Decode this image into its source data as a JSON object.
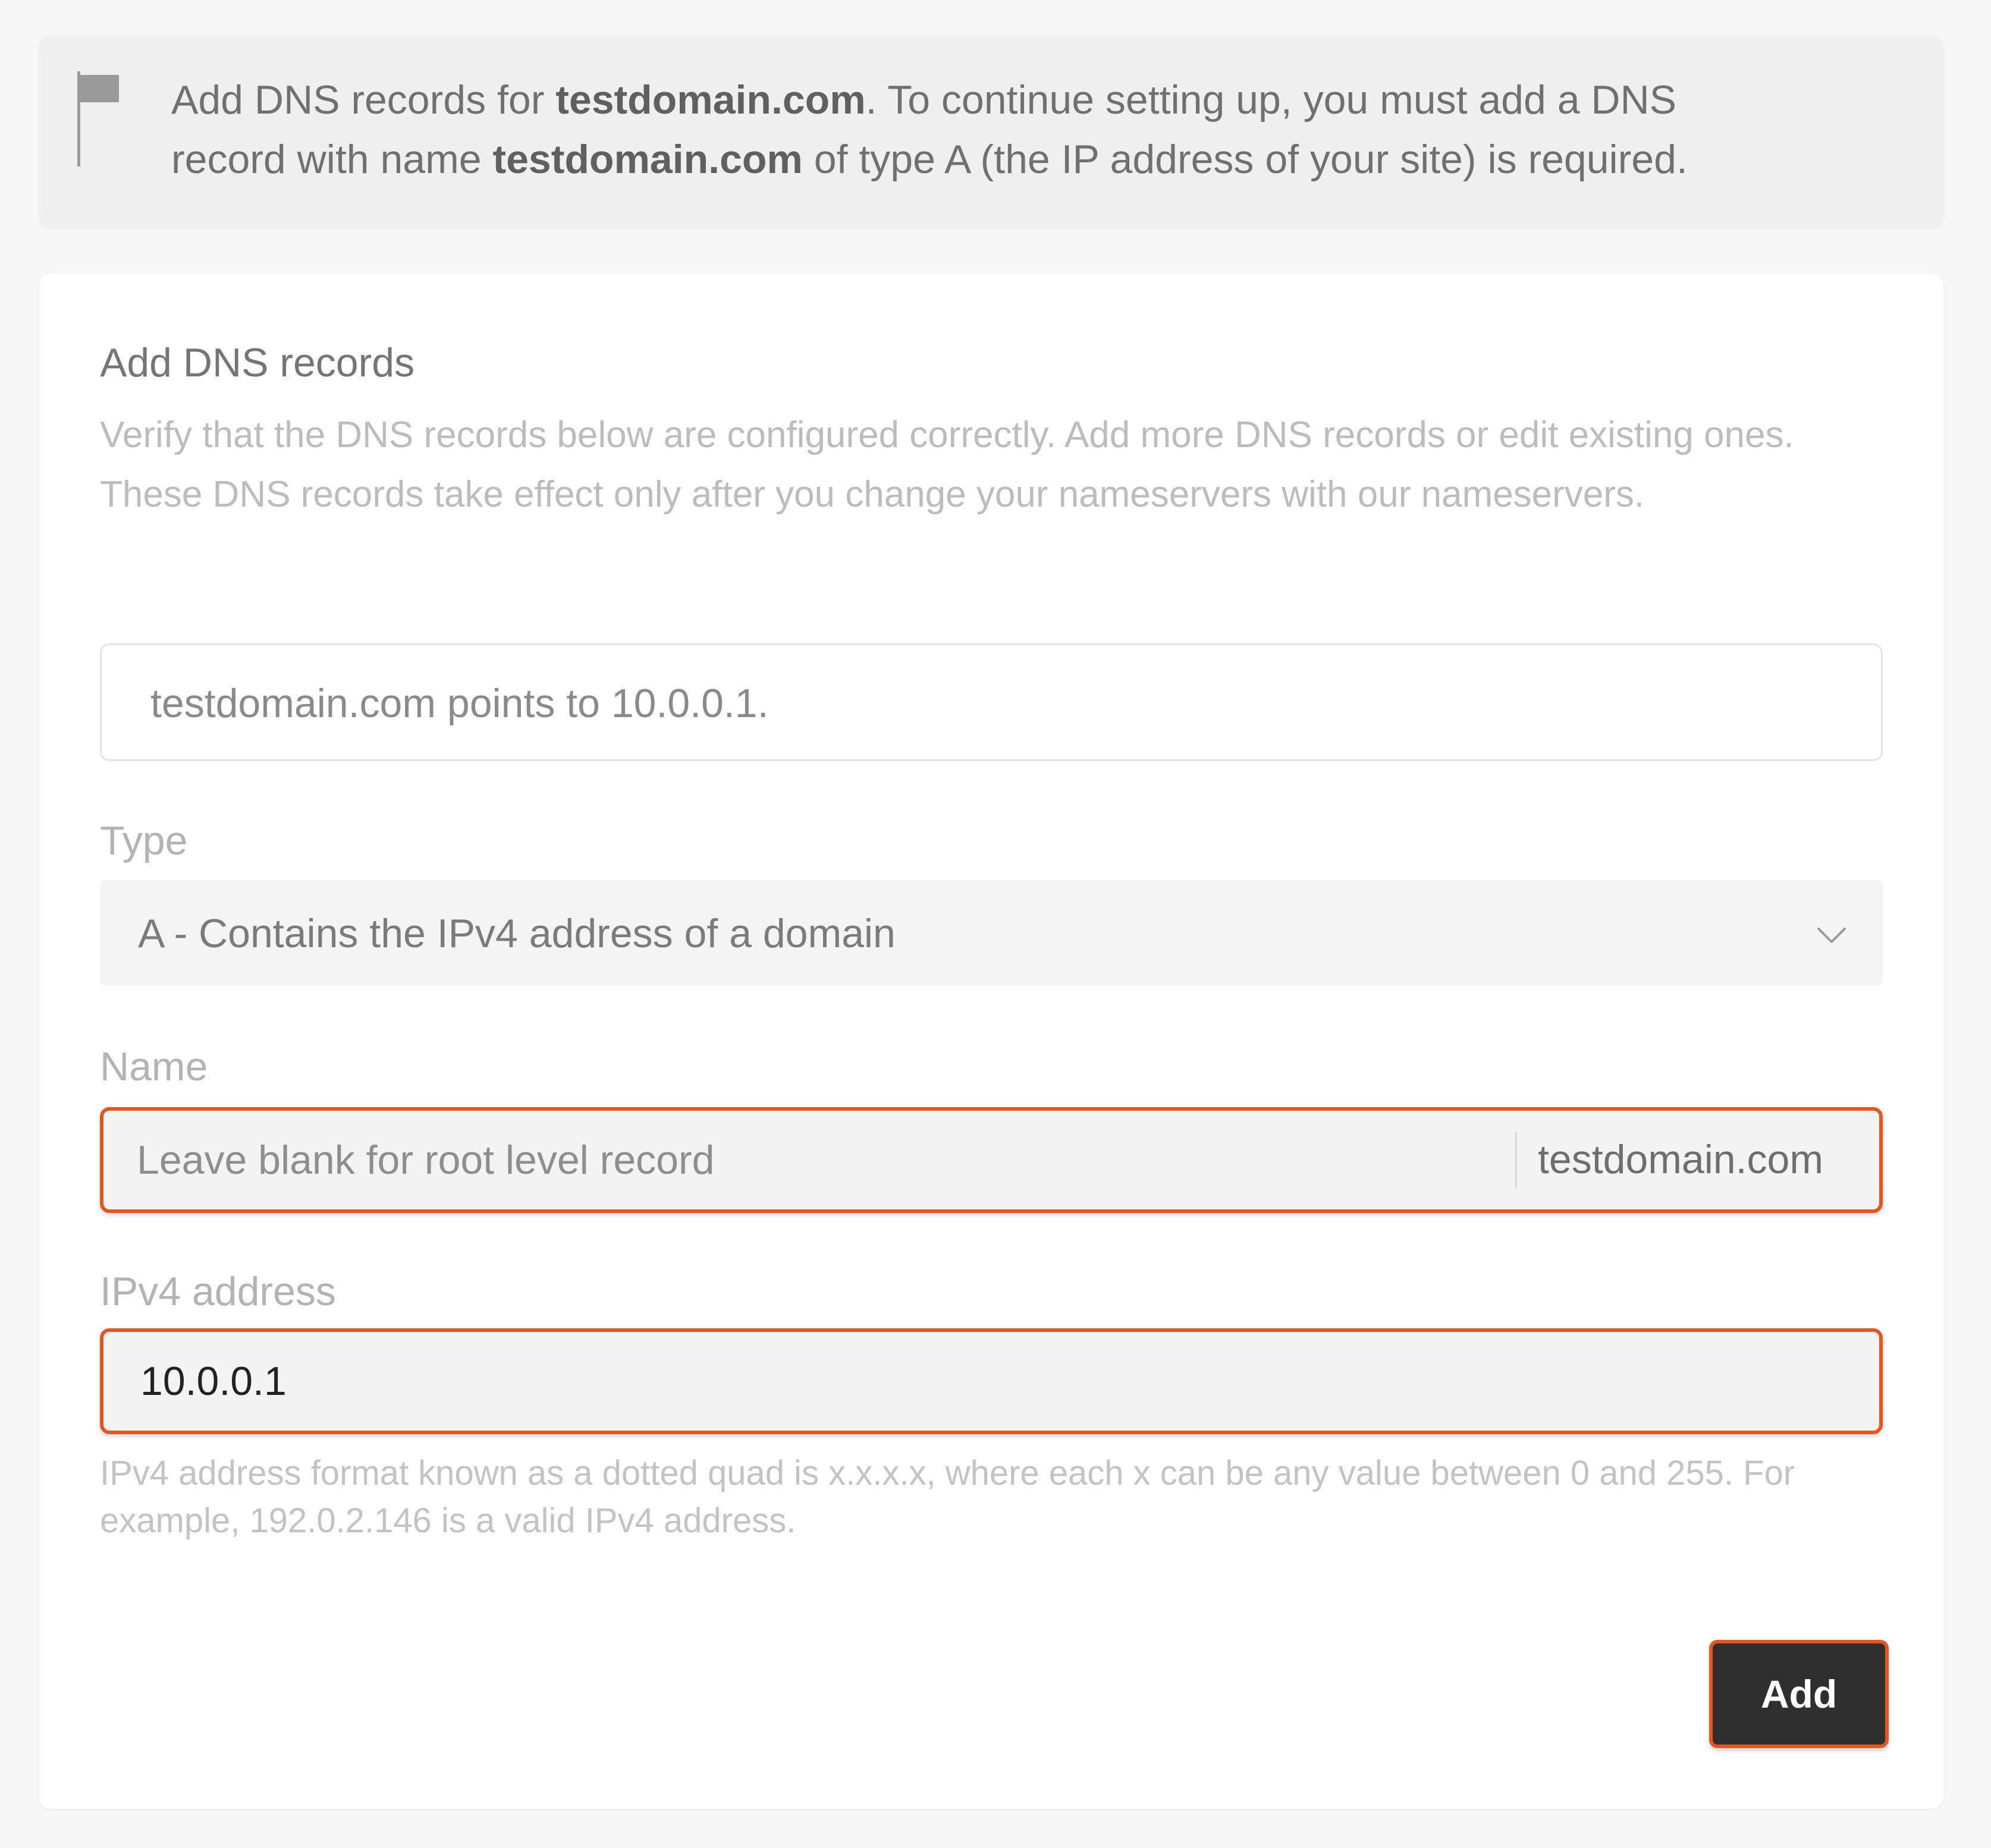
{
  "notice": {
    "icon": "flag-icon",
    "line1_pre": "Add DNS records for ",
    "line1_bold": "testdomain.com",
    "line1_post": ". To continue setting up, you must add a DNS",
    "line2_pre": "record with name ",
    "line2_bold": "testdomain.com",
    "line2_post": " of type A (the IP address of your site) is required."
  },
  "card": {
    "title": "Add DNS records",
    "description": "Verify that the DNS records below are configured correctly. Add more DNS records or edit existing ones. These DNS records take effect only after you change your nameservers with our nameservers.",
    "summary": "testdomain.com points to 10.0.0.1."
  },
  "type_field": {
    "label": "Type",
    "selected": "A - Contains the IPv4 address of a domain",
    "icon": "chevron-down-icon"
  },
  "name_field": {
    "label": "Name",
    "value": "",
    "placeholder": "Leave blank for root level record",
    "suffix": "testdomain.com"
  },
  "ipv4_field": {
    "label": "IPv4 address",
    "value": "10.0.0.1",
    "help": "IPv4 address format known as a dotted quad is x.x.x.x, where each x can be any value between 0 and 255. For example, 192.0.2.146 is a valid IPv4 address."
  },
  "actions": {
    "add_label": "Add"
  },
  "colors": {
    "accent": "#e8551b",
    "button_bg": "#2f2f2f"
  }
}
